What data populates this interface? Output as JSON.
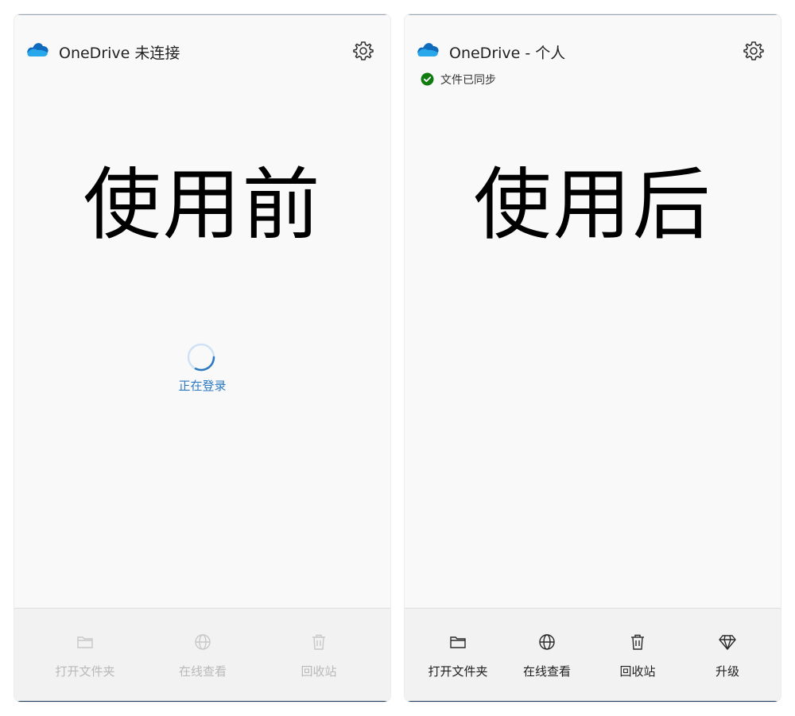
{
  "before": {
    "app_title": "OneDrive 未连接",
    "caption": "使用前",
    "loading_text": "正在登录",
    "footer": [
      {
        "label": "打开文件夹",
        "icon": "folder-icon",
        "enabled": false
      },
      {
        "label": "在线查看",
        "icon": "globe-icon",
        "enabled": false
      },
      {
        "label": "回收站",
        "icon": "trash-icon",
        "enabled": false
      }
    ]
  },
  "after": {
    "app_title": "OneDrive - 个人",
    "status_text": "文件已同步",
    "caption": "使用后",
    "footer": [
      {
        "label": "打开文件夹",
        "icon": "folder-icon",
        "enabled": true
      },
      {
        "label": "在线查看",
        "icon": "globe-icon",
        "enabled": true
      },
      {
        "label": "回收站",
        "icon": "trash-icon",
        "enabled": true
      },
      {
        "label": "升级",
        "icon": "diamond-icon",
        "enabled": true
      }
    ]
  },
  "colors": {
    "brand_blue": "#0f6cbd",
    "sync_green": "#107c10",
    "link_blue": "#2b78c2"
  }
}
